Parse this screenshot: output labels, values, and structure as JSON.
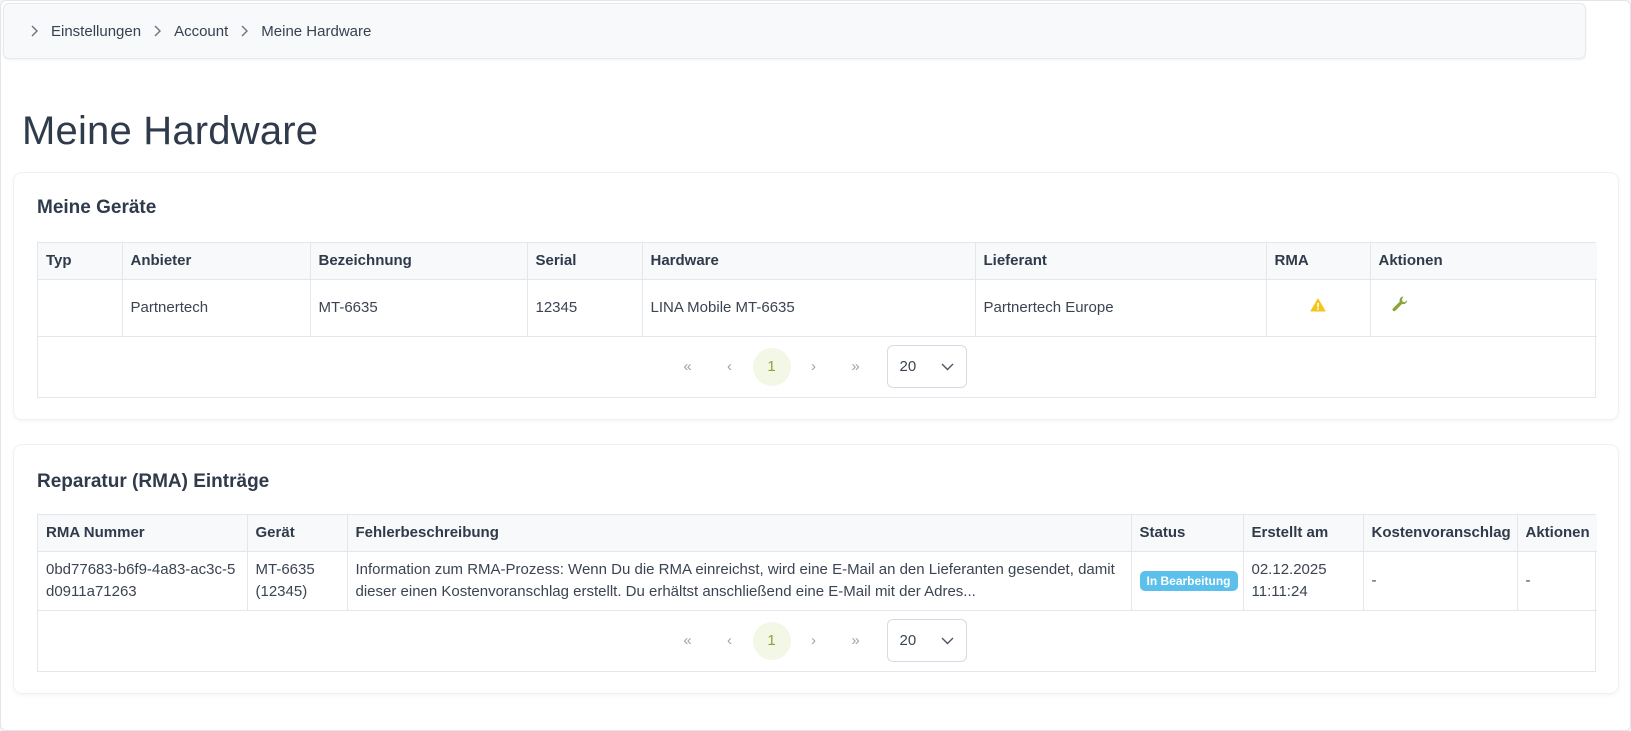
{
  "breadcrumb": [
    "Einstellungen",
    "Account",
    "Meine Hardware"
  ],
  "page_title": "Meine Hardware",
  "devices": {
    "title": "Meine Geräte",
    "columns": [
      "Typ",
      "Anbieter",
      "Bezeichnung",
      "Serial",
      "Hardware",
      "Lieferant",
      "RMA",
      "Aktionen"
    ],
    "rows": [
      {
        "typ": "",
        "anbieter": "Partnertech",
        "bezeichnung": "MT-6635",
        "serial": "12345",
        "hardware": "LINA Mobile MT-6635",
        "lieferant": "Partnertech Europe",
        "rma_icon": "warning-icon",
        "action_icon": "wrench-icon"
      }
    ],
    "pager": {
      "first": "«",
      "prev": "‹",
      "page": "1",
      "next": "›",
      "last": "»",
      "page_size": "20"
    }
  },
  "rma": {
    "title": "Reparatur (RMA) Einträge",
    "columns": [
      "RMA Nummer",
      "Gerät",
      "Fehlerbeschreibung",
      "Status",
      "Erstellt am",
      "Kostenvoranschlag",
      "Aktionen"
    ],
    "rows": [
      {
        "nummer": "0bd77683-b6f9-4a83-ac3c-5d0911a71263",
        "geraet": "MT-6635 (12345)",
        "beschreibung": "Information zum RMA-Prozess: Wenn Du die RMA einreichst, wird eine E-Mail an den Lieferanten gesendet, damit dieser einen Kostenvoranschlag erstellt. Du erhältst anschließend eine E-Mail mit der Adres...",
        "status": "In Bearbeitung",
        "erstellt": "02.12.2025 11:11:24",
        "kostenvoranschlag": "-",
        "aktionen": "-"
      }
    ],
    "pager": {
      "first": "«",
      "prev": "‹",
      "page": "1",
      "next": "›",
      "last": "»",
      "page_size": "20"
    }
  },
  "colors": {
    "accent_green": "#8aa43a",
    "warning_yellow": "#f5c518",
    "status_badge": "#5bc0eb"
  }
}
